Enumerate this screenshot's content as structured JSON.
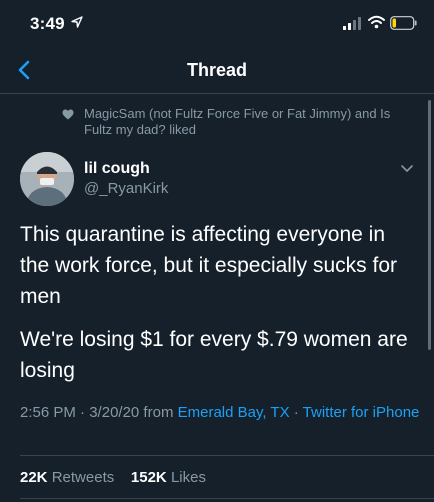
{
  "status_bar": {
    "time": "3:49"
  },
  "nav": {
    "title": "Thread"
  },
  "liked": {
    "text": "MagicSam (not Fultz Force Five or Fat Jimmy) and Is Fultz my dad? liked"
  },
  "author": {
    "name": "lil cough",
    "handle": "@_RyanKirk"
  },
  "tweet": {
    "paragraph_1": "This quarantine is affecting everyone in the work force, but it especially sucks for men",
    "paragraph_2": "We're losing $1 for every $.79 women are losing"
  },
  "meta": {
    "time": "2:56 PM",
    "sep1": " · ",
    "date": "3/20/20",
    "from": " from ",
    "location": "Emerald Bay, TX",
    "sep2": " · ",
    "source": "Twitter for iPhone"
  },
  "stats": {
    "retweets_count": "22K",
    "retweets_label": "Retweets",
    "likes_count": "152K",
    "likes_label": "Likes"
  },
  "colors": {
    "background": "#15202b",
    "secondary_text": "#8899a6",
    "link": "#1da1f2",
    "divider": "#38444d"
  },
  "icons": [
    "location-arrow-icon",
    "signal-icon",
    "wifi-icon",
    "battery-icon",
    "back-chevron-icon",
    "heart-icon",
    "chevron-down-icon"
  ]
}
